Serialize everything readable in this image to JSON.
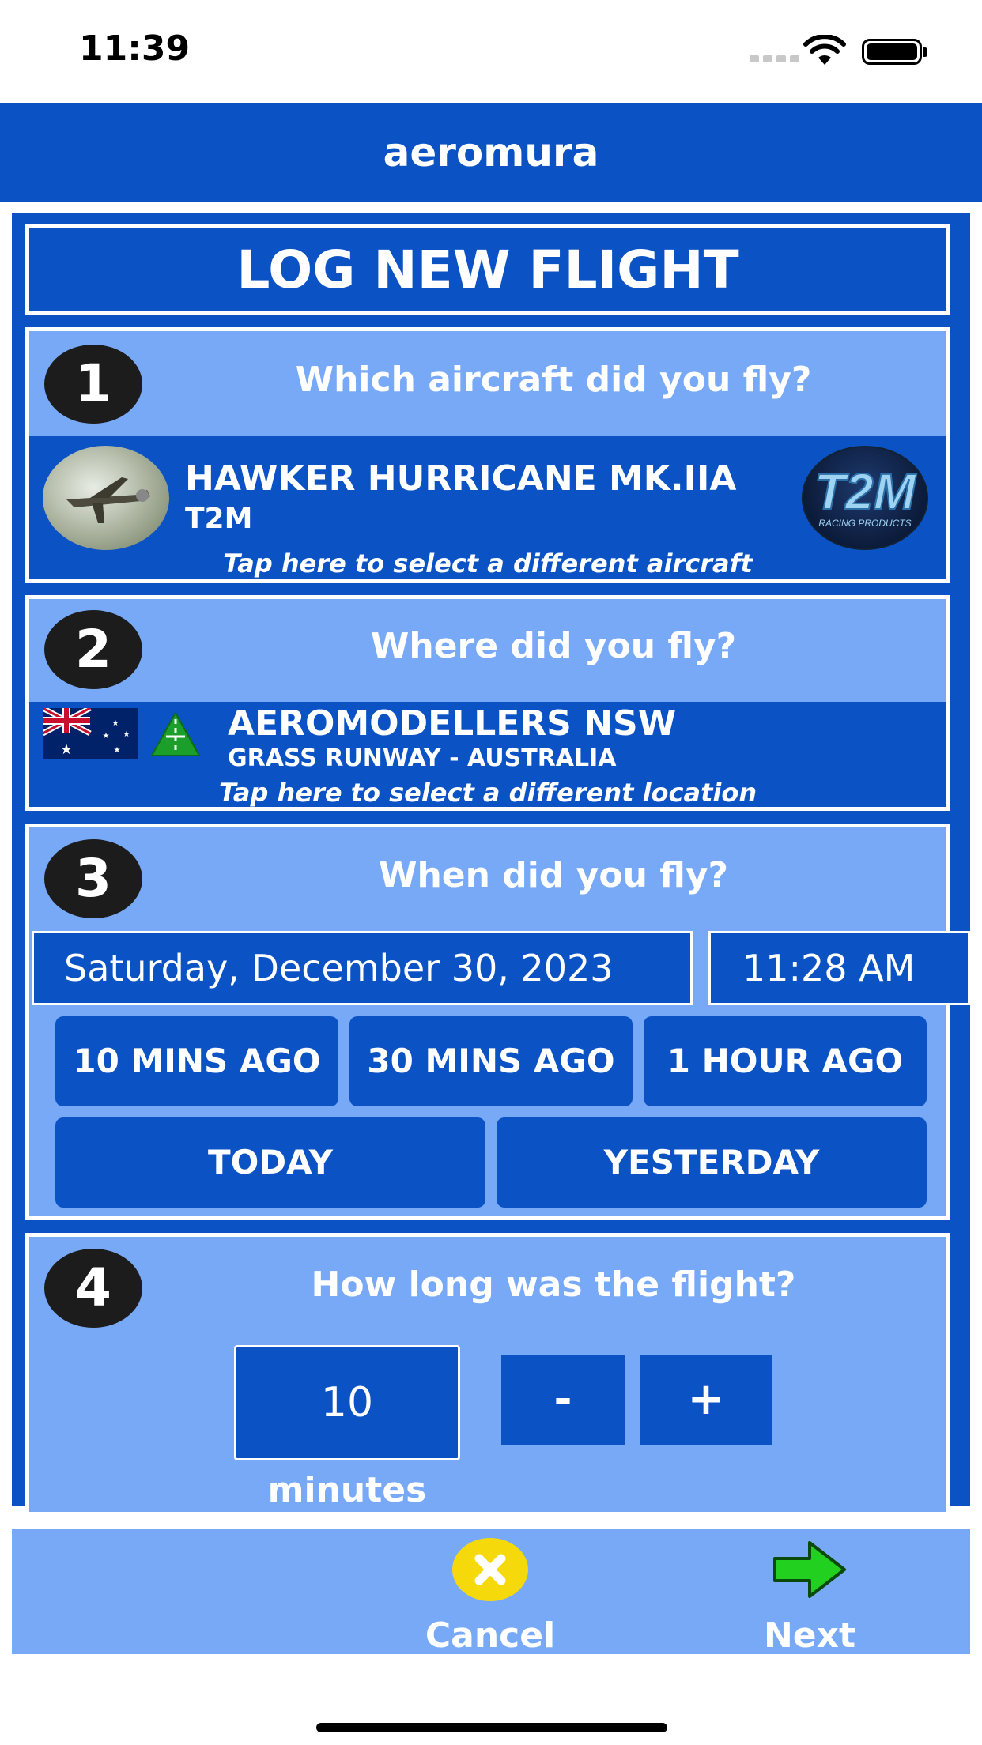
{
  "status": {
    "time": "11:39"
  },
  "header": {
    "title": "aeromura"
  },
  "page_title": "LOG NEW FLIGHT",
  "step1": {
    "number": "1",
    "question": "Which aircraft did you fly?",
    "aircraft_name": "HAWKER HURRICANE MK.IIA",
    "manufacturer": "T2M",
    "hint": "Tap here to select a different aircraft"
  },
  "step2": {
    "number": "2",
    "question": "Where did you fly?",
    "location_name": "AEROMODELLERS NSW",
    "location_detail": "GRASS RUNWAY - AUSTRALIA",
    "hint": "Tap here to select a different location"
  },
  "step3": {
    "number": "3",
    "question": "When did you fly?",
    "date": "Saturday, December 30, 2023",
    "time": "11:28 AM",
    "quick": [
      "10 MINS AGO",
      "30 MINS AGO",
      "1 HOUR AGO"
    ],
    "today": "TODAY",
    "yesterday": "YESTERDAY"
  },
  "step4": {
    "number": "4",
    "question": "How long was the flight?",
    "duration": "10",
    "minus": "-",
    "plus": "+",
    "unit": "minutes"
  },
  "footer": {
    "cancel": "Cancel",
    "next": "Next"
  },
  "colors": {
    "primary": "#0b52c4",
    "light": "#78a9f7",
    "cancel": "#f5d90a",
    "next": "#22d11f"
  }
}
